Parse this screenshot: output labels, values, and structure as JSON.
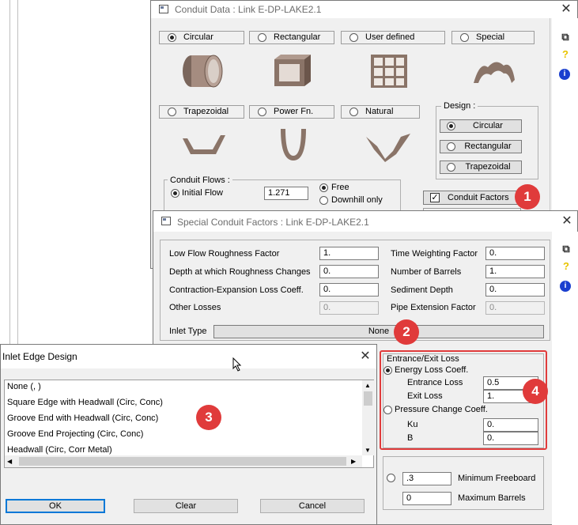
{
  "conduit_window": {
    "title": "Conduit Data : Link E-DP-LAKE2.1",
    "tabs_row1": [
      "Circular",
      "Rectangular",
      "User defined",
      "Special"
    ],
    "tabs_row2": [
      "Trapezoidal",
      "Power Fn.",
      "Natural"
    ],
    "selected_shape": "Circular",
    "design": {
      "title": "Design :",
      "options": [
        "Circular",
        "Rectangular",
        "Trapezoidal"
      ],
      "selected": "Circular"
    },
    "flows": {
      "title": "Conduit Flows :",
      "initial_flow_label": "Initial Flow",
      "initial_flow_value": "1.271",
      "free_label": "Free",
      "downhill_label": "Downhill only",
      "selected": "Free"
    },
    "conduit_factors_label": "Conduit Factors",
    "conduit_factors_checked": true
  },
  "side_tools": {
    "copy_icon": "copy-icon",
    "help_icon": "?",
    "info_icon": "i"
  },
  "factors_window": {
    "title": "Special Conduit Factors : Link E-DP-LAKE2.1",
    "left_fields": [
      {
        "label": "Low Flow Roughness Factor",
        "value": "1."
      },
      {
        "label": "Depth at which Roughness Changes",
        "value": "0."
      },
      {
        "label": "Contraction-Expansion Loss Coeff.",
        "value": "0."
      },
      {
        "label": "Other Losses",
        "value": "0."
      }
    ],
    "right_fields": [
      {
        "label": "Time Weighting Factor",
        "value": "0."
      },
      {
        "label": "Number of Barrels",
        "value": "1."
      },
      {
        "label": "Sediment Depth",
        "value": "0."
      },
      {
        "label": "Pipe Extension Factor",
        "value": "0."
      }
    ],
    "inlet_type_label": "Inlet Type",
    "inlet_type_value": "None",
    "entrance_exit": {
      "title": "Entrance/Exit Loss",
      "energy_label": "Energy Loss Coeff.",
      "entrance_label": "Entrance Loss",
      "entrance_value": "0.5",
      "exit_label": "Exit Loss",
      "exit_value": "1.",
      "pressure_label": "Pressure Change Coeff.",
      "ku_label": "Ku",
      "ku_value": "0.",
      "b_label": "B",
      "b_value": "0."
    },
    "min_freeboard_value": ".3",
    "min_freeboard_label": "Minimum Freeboard",
    "max_barrels_value": "0",
    "max_barrels_label": "Maximum Barrels"
  },
  "inlet_dialog": {
    "title": "Inlet Edge Design",
    "items": [
      "None (, )",
      "Square Edge with Headwall (Circ, Conc)",
      "Groove End with Headwall (Circ, Conc)",
      "Groove End Projecting (Circ, Conc)",
      "Headwall (Circ, Corr Metal)"
    ],
    "ok_label": "OK",
    "clear_label": "Clear",
    "cancel_label": "Cancel"
  },
  "badges": [
    "1",
    "2",
    "3",
    "4"
  ],
  "colors": {
    "badge": "#e03b3b",
    "pipe": "#8a7468",
    "info_blue": "#1a3fcf",
    "help_yellow": "#e8c400"
  }
}
